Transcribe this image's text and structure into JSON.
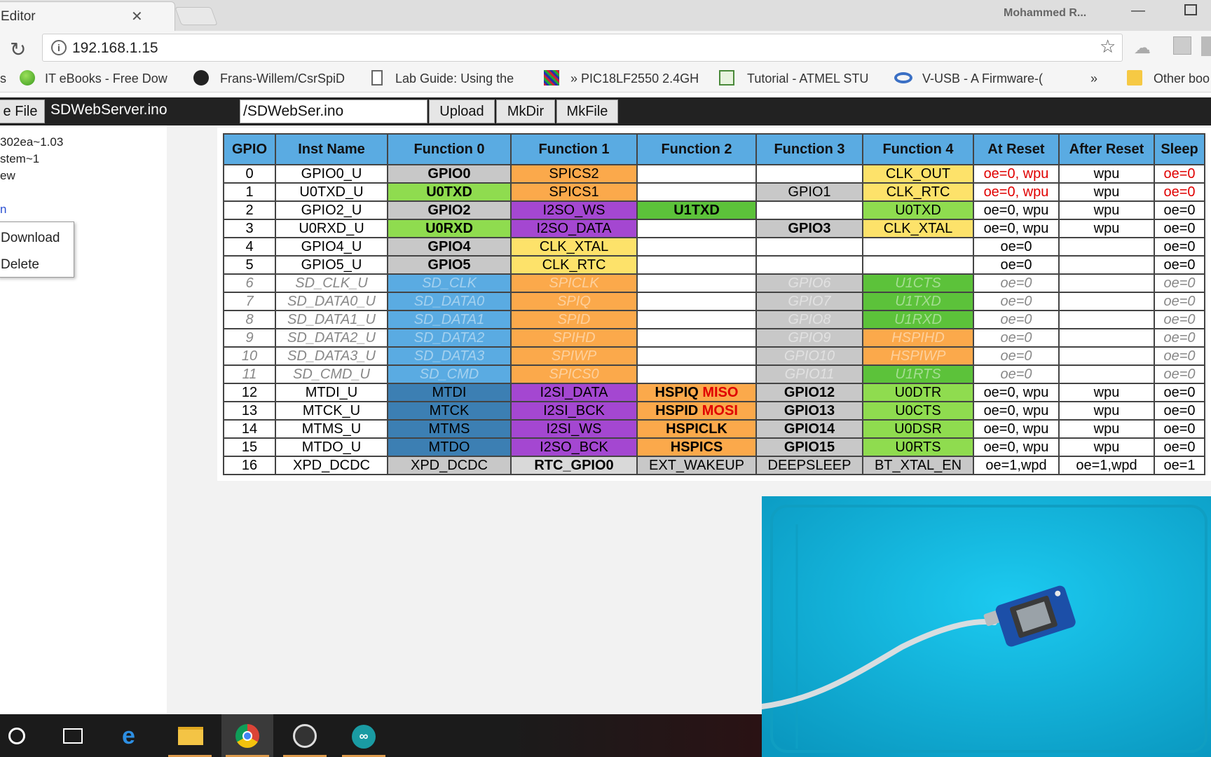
{
  "browser": {
    "tab_title": "Editor",
    "profile_name": "Mohammed R...",
    "url": "192.168.1.15",
    "bookmarks": [
      {
        "label": "IT eBooks - Free Dow"
      },
      {
        "label": "Frans-Willem/CsrSpiD"
      },
      {
        "label": "Lab Guide: Using the"
      },
      {
        "label": "» PIC18LF2550 2.4GH"
      },
      {
        "label": "Tutorial - ATMEL STU"
      },
      {
        "label": "V-USB - A Firmware-("
      },
      {
        "label": "»"
      },
      {
        "label": "Other boo"
      }
    ]
  },
  "editor": {
    "save_file_label": "e File",
    "file_name": "SDWebServer.ino",
    "path_value": "/SDWebSer.ino",
    "upload_label": "Upload",
    "mkdir_label": "MkDir",
    "mkfile_label": "MkFile"
  },
  "tree": {
    "items": [
      "302ea~1.03",
      "stem~1",
      "ew",
      "n"
    ],
    "context_menu": {
      "download": "Download",
      "delete": "Delete"
    }
  },
  "table": {
    "headers": [
      "GPIO",
      "Inst Name",
      "Function 0",
      "Function 1",
      "Function 2",
      "Function 3",
      "Function 4",
      "At Reset",
      "After Reset",
      "Sleep"
    ],
    "rows": [
      [
        "0",
        "GPIO0_U",
        "GPIO0",
        "SPICS2",
        "",
        "",
        "CLK_OUT",
        "oe=0, wpu",
        "wpu",
        "oe=0"
      ],
      [
        "1",
        "U0TXD_U",
        "U0TXD",
        "SPICS1",
        "",
        "GPIO1",
        "CLK_RTC",
        "oe=0, wpu",
        "wpu",
        "oe=0"
      ],
      [
        "2",
        "GPIO2_U",
        "GPIO2",
        "I2SO_WS",
        "U1TXD",
        "",
        "U0TXD",
        "oe=0, wpu",
        "wpu",
        "oe=0"
      ],
      [
        "3",
        "U0RXD_U",
        "U0RXD",
        "I2SO_DATA",
        "",
        "GPIO3",
        "CLK_XTAL",
        "oe=0, wpu",
        "wpu",
        "oe=0"
      ],
      [
        "4",
        "GPIO4_U",
        "GPIO4",
        "CLK_XTAL",
        "",
        "",
        "",
        "oe=0",
        "",
        "oe=0"
      ],
      [
        "5",
        "GPIO5_U",
        "GPIO5",
        "CLK_RTC",
        "",
        "",
        "",
        "oe=0",
        "",
        "oe=0"
      ],
      [
        "6",
        "SD_CLK_U",
        "SD_CLK",
        "SPICLK",
        "",
        "GPIO6",
        "U1CTS",
        "oe=0",
        "",
        "oe=0"
      ],
      [
        "7",
        "SD_DATA0_U",
        "SD_DATA0",
        "SPIQ",
        "",
        "GPIO7",
        "U1TXD",
        "oe=0",
        "",
        "oe=0"
      ],
      [
        "8",
        "SD_DATA1_U",
        "SD_DATA1",
        "SPID",
        "",
        "GPIO8",
        "U1RXD",
        "oe=0",
        "",
        "oe=0"
      ],
      [
        "9",
        "SD_DATA2_U",
        "SD_DATA2",
        "SPIHD",
        "",
        "GPIO9",
        "HSPIHD",
        "oe=0",
        "",
        "oe=0"
      ],
      [
        "10",
        "SD_DATA3_U",
        "SD_DATA3",
        "SPIWP",
        "",
        "GPIO10",
        "HSPIWP",
        "oe=0",
        "",
        "oe=0"
      ],
      [
        "11",
        "SD_CMD_U",
        "SD_CMD",
        "SPICS0",
        "",
        "GPIO11",
        "U1RTS",
        "oe=0",
        "",
        "oe=0"
      ],
      [
        "12",
        "MTDI_U",
        "MTDI",
        "I2SI_DATA",
        "HSPIQ",
        "GPIO12",
        "U0DTR",
        "oe=0, wpu",
        "wpu",
        "oe=0"
      ],
      [
        "13",
        "MTCK_U",
        "MTCK",
        "I2SI_BCK",
        "HSPID",
        "GPIO13",
        "U0CTS",
        "oe=0, wpu",
        "wpu",
        "oe=0"
      ],
      [
        "14",
        "MTMS_U",
        "MTMS",
        "I2SI_WS",
        "HSPICLK",
        "GPIO14",
        "U0DSR",
        "oe=0, wpu",
        "wpu",
        "oe=0"
      ],
      [
        "15",
        "MTDO_U",
        "MTDO",
        "I2SO_BCK",
        "HSPICS",
        "GPIO15",
        "U0RTS",
        "oe=0, wpu",
        "wpu",
        "oe=0"
      ],
      [
        "16",
        "XPD_DCDC",
        "XPD_DCDC",
        "RTC_GPIO0",
        "EXT_WAKEUP",
        "DEEPSLEEP",
        "BT_XTAL_EN",
        "oe=1,wpd",
        "oe=1,wpd",
        "oe=1"
      ]
    ],
    "suffix_miso": "MISO",
    "suffix_mosi": "MOSI"
  },
  "colors": {
    "header": "#5aabe2",
    "gray": "#c8c8c8",
    "green": "#8fdc4f",
    "orange": "#fba94b",
    "purple": "#a447d1",
    "yellow": "#fde26a",
    "lightblue": "#5aabe2",
    "steelblue": "#3c7fb3",
    "darkgreen": "#5cc23a",
    "red_text": "#e00000"
  }
}
